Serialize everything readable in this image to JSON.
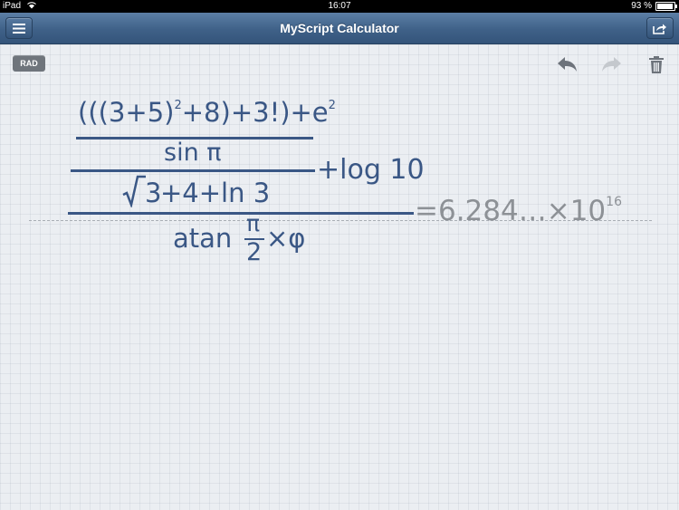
{
  "status": {
    "device": "iPad",
    "time": "16:07",
    "battery": "93 %",
    "battery_level": 0.93
  },
  "nav": {
    "title": "MyScript Calculator",
    "menu_icon": "menu-icon",
    "share_icon": "share-icon"
  },
  "toolbar": {
    "mode": "RAD",
    "undo_icon": "undo-icon",
    "redo_icon": "redo-icon",
    "trash_icon": "trash-icon"
  },
  "expression": {
    "top_numerator": "(((3+5)",
    "top_exp": "2",
    "top_rest": "+8)+3!)+e",
    "top_e_exp": "2",
    "sin": "sin π",
    "sqrt_arg": "3",
    "after_sqrt": "+4+ln 3",
    "plus_log": "+log 10",
    "atan": "atan",
    "pi_num": "π",
    "pi_den": "2",
    "times_phi": "×φ"
  },
  "result": {
    "text": "=6.284…×10",
    "exp": "16"
  },
  "colors": {
    "ink": "#3a5785",
    "result": "#8d9196",
    "nav": "#3f6188"
  }
}
